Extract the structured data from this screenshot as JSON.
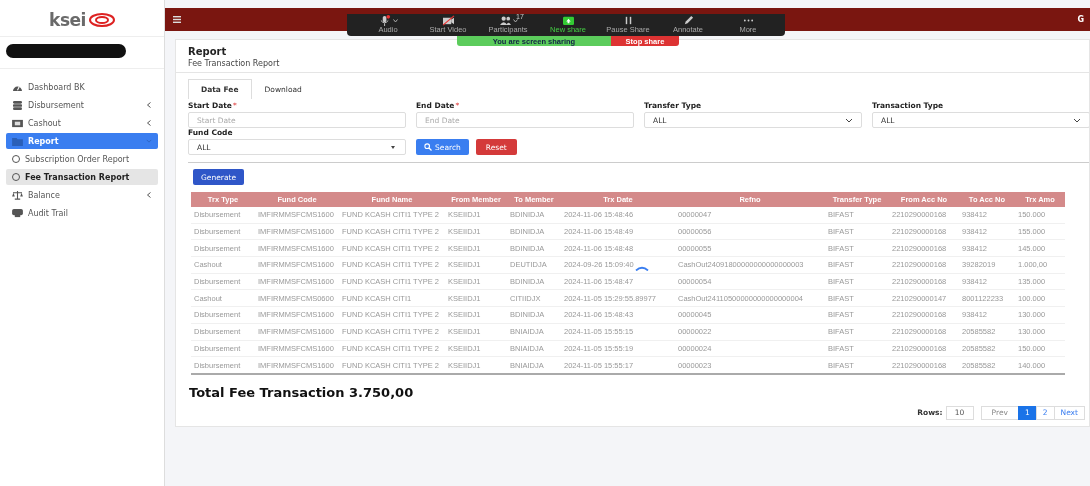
{
  "sidebar": {
    "logo_text": "ksei",
    "items": [
      {
        "label": "Dashboard BK",
        "kind": "menu",
        "selected": false,
        "expandable": false
      },
      {
        "label": "Disbursement",
        "kind": "menu",
        "selected": false,
        "expandable": true
      },
      {
        "label": "Cashout",
        "kind": "menu",
        "selected": false,
        "expandable": true
      },
      {
        "label": "Report",
        "kind": "menu",
        "selected": true,
        "expandable": true
      },
      {
        "label": "Subscription Order Report",
        "kind": "sub",
        "selected": false
      },
      {
        "label": "Fee Transaction Report",
        "kind": "sub",
        "selected": true
      },
      {
        "label": "Balance",
        "kind": "menu",
        "selected": false,
        "expandable": true
      },
      {
        "label": "Audit Trail",
        "kind": "menu",
        "selected": false,
        "expandable": false
      }
    ]
  },
  "header": {
    "user_initial": "G"
  },
  "meeting_toolbar": {
    "items": [
      {
        "label": "Audio",
        "caret": true
      },
      {
        "label": "Start Video",
        "caret": false
      },
      {
        "label": "Participants",
        "caret": true,
        "count": "17"
      },
      {
        "label": "New share",
        "caret": false
      },
      {
        "label": "Pause Share",
        "caret": false
      },
      {
        "label": "Annotate",
        "caret": false
      },
      {
        "label": "More",
        "caret": false
      }
    ],
    "sharing_text": "You are screen sharing",
    "stop_label": "Stop share"
  },
  "page": {
    "title": "Report",
    "subtitle": "Fee Transaction Report",
    "tabs": [
      {
        "label": "Data Fee",
        "selected": true
      },
      {
        "label": "Download",
        "selected": false
      }
    ],
    "filters": [
      {
        "label": "Start Date",
        "required_mark": "*",
        "kind": "input",
        "placeholder": "Start Date"
      },
      {
        "label": "End Date",
        "required_mark": "*",
        "kind": "input",
        "placeholder": "End Date"
      },
      {
        "label": "Transfer Type",
        "kind": "select",
        "value": "ALL"
      },
      {
        "label": "Transaction Type",
        "kind": "select",
        "value": "ALL"
      },
      {
        "label": "Fund Code",
        "kind": "select_small",
        "value": "ALL"
      }
    ],
    "search_button": "Search",
    "reset_button": "Reset",
    "generate_button": "Generate",
    "table": {
      "columns": [
        "Trx Type",
        "Fund Code",
        "Fund Name",
        "From Member",
        "To Member",
        "Trx Date",
        "Refno",
        "Transfer Type",
        "From Acc No",
        "To Acc No",
        "Trx Amo"
      ],
      "rows": [
        [
          "Disbursement",
          "IMFIRMMSFCMS1600",
          "FUND KCASH CITI1 TYPE 2",
          "KSEIIDJ1",
          "BDINIDJA",
          "2024-11-06 15:48:46",
          "00000047",
          "BIFAST",
          "2210290000168",
          "938412",
          "150.000"
        ],
        [
          "Disbursement",
          "IMFIRMMSFCMS1600",
          "FUND KCASH CITI1 TYPE 2",
          "KSEIIDJ1",
          "BDINIDJA",
          "2024-11-06 15:48:49",
          "00000056",
          "BIFAST",
          "2210290000168",
          "938412",
          "155.000"
        ],
        [
          "Disbursement",
          "IMFIRMMSFCMS1600",
          "FUND KCASH CITI1 TYPE 2",
          "KSEIIDJ1",
          "BDINIDJA",
          "2024-11-06 15:48:48",
          "00000055",
          "BIFAST",
          "2210290000168",
          "938412",
          "145.000"
        ],
        [
          "Cashout",
          "IMFIRMMSFCMS1600",
          "FUND KCASH CITI1 TYPE 2",
          "KSEIIDJ1",
          "DEUTIDJA",
          "2024-09-26 15:09:40",
          "CashOut24091800000000000000003",
          "BIFAST",
          "2210290000168",
          "39282019",
          "1.000,00"
        ],
        [
          "Disbursement",
          "IMFIRMMSFCMS1600",
          "FUND KCASH CITI1 TYPE 2",
          "KSEIIDJ1",
          "BDINIDJA",
          "2024-11-06 15:48:47",
          "00000054",
          "BIFAST",
          "2210290000168",
          "938412",
          "135.000"
        ],
        [
          "Cashout",
          "IMFIRMMSFCMS0600",
          "FUND KCASH CITI1",
          "KSEIIDJ1",
          "CITIIDJX",
          "2024-11-05 15:29:55.89977",
          "CashOut24110500000000000000004",
          "BIFAST",
          "2210290000147",
          "8001122233",
          "100.000"
        ],
        [
          "Disbursement",
          "IMFIRMMSFCMS1600",
          "FUND KCASH CITI1 TYPE 2",
          "KSEIIDJ1",
          "BDINIDJA",
          "2024-11-06 15:48:43",
          "00000045",
          "BIFAST",
          "2210290000168",
          "938412",
          "130.000"
        ],
        [
          "Disbursement",
          "IMFIRMMSFCMS1600",
          "FUND KCASH CITI1 TYPE 2",
          "KSEIIDJ1",
          "BNIAIDJA",
          "2024-11-05 15:55:15",
          "00000022",
          "BIFAST",
          "2210290000168",
          "20585582",
          "130.000"
        ],
        [
          "Disbursement",
          "IMFIRMMSFCMS1600",
          "FUND KCASH CITI1 TYPE 2",
          "KSEIIDJ1",
          "BNIAIDJA",
          "2024-11-05 15:55:19",
          "00000024",
          "BIFAST",
          "2210290000168",
          "20585582",
          "150.000"
        ],
        [
          "Disbursement",
          "IMFIRMMSFCMS1600",
          "FUND KCASH CITI1 TYPE 2",
          "KSEIIDJ1",
          "BNIAIDJA",
          "2024-11-05 15:55:17",
          "00000023",
          "BIFAST",
          "2210290000168",
          "20585582",
          "140.000"
        ]
      ]
    },
    "total": "Total Fee Transaction 3.750,00",
    "pagination": {
      "rows_label": "Rows:",
      "rows_value": "10",
      "prev": "Prev",
      "pages": [
        {
          "label": "1",
          "selected": true
        },
        {
          "label": "2",
          "selected": false
        }
      ],
      "next": "Next"
    }
  }
}
